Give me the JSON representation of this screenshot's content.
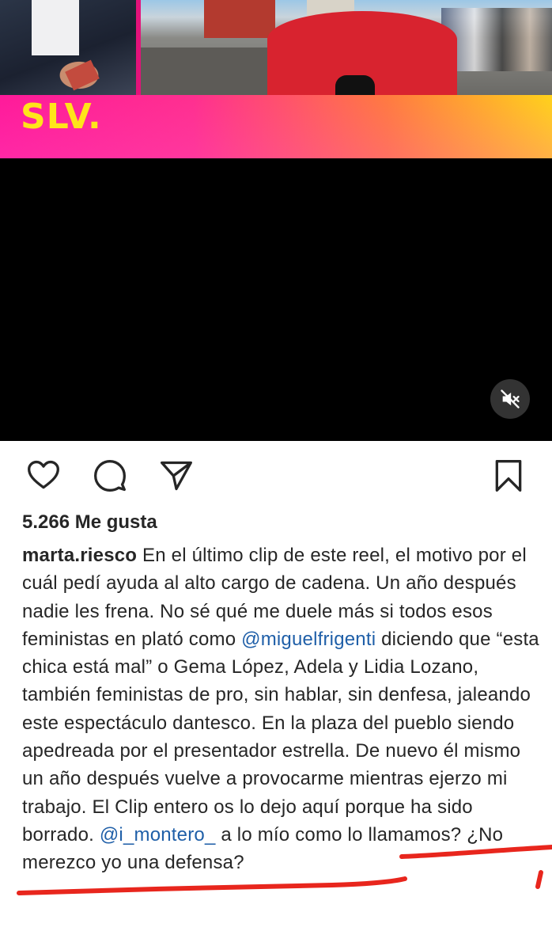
{
  "video": {
    "overlay_logo": "SLV.",
    "mute_icon": "speaker-muted-icon",
    "banner_colors": [
      "#ff1a9a",
      "#ff7a40",
      "#ffd21a"
    ]
  },
  "actions": {
    "like_icon": "heart-icon",
    "comment_icon": "comment-bubble-icon",
    "share_icon": "send-paper-plane-icon",
    "save_icon": "bookmark-icon"
  },
  "post": {
    "likes": "5.266 Me gusta",
    "username": "marta.riesco",
    "caption_parts": {
      "p1": " En el último clip de este reel, el motivo por el cuál pedí ayuda al alto cargo de cadena. Un año después nadie les frena. No sé qué me duele más si todos esos feministas en plató como ",
      "mention1": "@miguelfrigenti",
      "p2": " diciendo que “esta chica está mal” o Gema López, Adela y Lidia Lozano, también feministas de pro, sin hablar, sin denfesa, jaleando este espectáculo dantesco. En la plaza del pueblo siendo apedreada por el presentador estrella. De nuevo él mismo un año después vuelve a provocarme mientras ejerzo mi trabajo. El Clip entero os lo dejo aquí porque ha sido borrado. ",
      "mention2": "@i_montero_",
      "p3": " a lo mío como lo llamamos? ¿No merezco yo una defensa?"
    },
    "mention_color": "#1f5fa8"
  },
  "annotation": {
    "color": "#e8261d"
  }
}
